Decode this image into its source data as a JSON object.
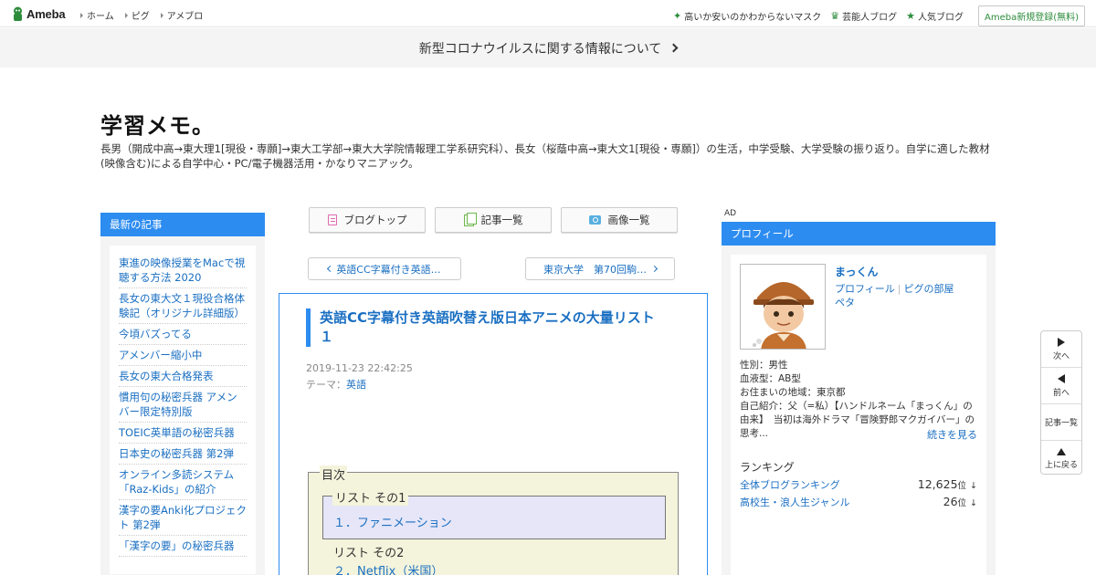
{
  "topbar": {
    "logo": "Ameba",
    "nav": [
      "ホーム",
      "ピグ",
      "アメブロ"
    ],
    "right_links": [
      {
        "icon": "sparkle-icon",
        "label": "高いか安いのかわからないマスク"
      },
      {
        "icon": "crown-icon",
        "label": "芸能人ブログ"
      },
      {
        "icon": "star-icon",
        "label": "人気ブログ"
      }
    ],
    "register": "Ameba新規登録(無料)"
  },
  "notice": "新型コロナウイルスに関する情報について",
  "blog": {
    "title": "学習メモ。",
    "description": "長男（開成中高→東大理1[現役・専願]→東大工学部→東大大学院情報理工学系研究科）、長女（桜蔭中高→東大文1[現役・専願]）の生活，中学受験、大学受験の振り返り。自学に適した教材(映像含む)による自学中心・PC/電子機器活用・かなりマニアック。"
  },
  "sidebar": {
    "heading": "最新の記事",
    "items": [
      "東進の映像授業をMacで視聴する方法 2020",
      "長女の東大文１現役合格体験記（オリジナル詳細版）",
      "今頃バズってる",
      "アメンバー縮小中",
      "長女の東大合格発表",
      "慣用句の秘密兵器 アメンバー限定特別版",
      "TOEIC英単語の秘密兵器",
      "日本史の秘密兵器 第2弾",
      "オンライン多読システム「Raz-Kids」の紹介",
      "漢字の要Anki化プロジェクト 第2弾",
      "「漢字の要」の秘密兵器"
    ]
  },
  "toolbar": {
    "blog_top": "ブログトップ",
    "article_list": "記事一覧",
    "image_list": "画像一覧"
  },
  "pager": {
    "prev": "英語CC字幕付き英語…",
    "next": "東京大学　第70回駒…"
  },
  "article": {
    "title": "英語CC字幕付き英語吹替え版日本アニメの大量リスト１",
    "date": "2019-11-23 22:42:25",
    "theme_label": "テーマ：",
    "theme": "英語",
    "toc": {
      "legend": "目次",
      "section1_label": "リスト その1",
      "section1_link": "１．ファニメーション",
      "section2_label": "リスト その2",
      "section2_link": "２．Netflix（米国）"
    }
  },
  "ad_label": "AD",
  "profile": {
    "heading": "プロフィール",
    "name": "まっくん",
    "link_profile": "プロフィール",
    "link_room": "ピグの部屋",
    "link_peta": "ペタ",
    "info": [
      "性別：男性",
      "血液型：AB型",
      "お住まいの地域：東京都",
      "自己紹介：父（=私）【ハンドルネーム「まっくん」の由来】　当初は海外ドラマ「冒険野郎マクガイバー」の思考..."
    ],
    "more": "続きを見る",
    "ranking_heading": "ランキング",
    "rankings": [
      {
        "label": "全体ブログランキング",
        "value": "12,625",
        "unit": "位",
        "trend": "↓"
      },
      {
        "label": "高校生・浪人生ジャンル",
        "value": "26",
        "unit": "位",
        "trend": "↓"
      }
    ]
  },
  "floatnav": {
    "next": "次へ",
    "prev": "前へ",
    "list": "記事一覧",
    "top": "上に戻る"
  },
  "colors": {
    "accent_blue": "#2d8cf0",
    "link_blue": "#1a6fc2",
    "ameba_green": "#2d8c3c"
  }
}
